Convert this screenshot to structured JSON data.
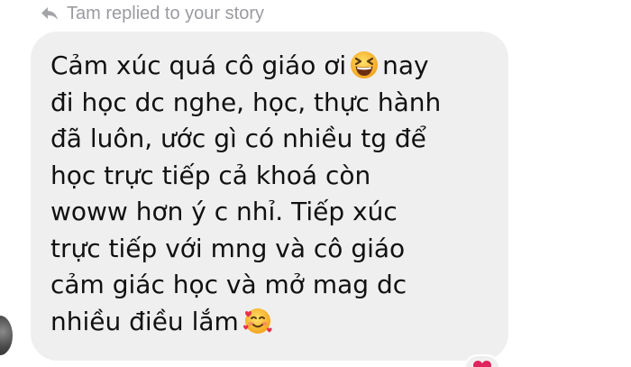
{
  "reply_header": {
    "icon": "reply-arrow-icon",
    "text": "Tam replied to your story"
  },
  "message": {
    "lines": [
      "Cảm xúc quá cô giáo ơi",
      "nay",
      "đi học dc nghe, học, thực hành",
      "đã luôn, ước gì có nhiều tg để",
      "học trực tiếp cả khoá còn",
      "woww hơn ý c nhỉ. Tiếp xúc",
      "trực tiếp với mng và cô giáo",
      "cảm giác học và mở mag dc",
      "nhiều điều lắm"
    ],
    "emojis": [
      "grinning-squinting-face-emoji",
      "smiling-face-with-hearts-emoji"
    ]
  },
  "reaction": {
    "icon": "heart-icon",
    "color": "#e0245e"
  },
  "colors": {
    "bubble": "#efeff0",
    "text": "#111111",
    "header": "#9a9ba0"
  }
}
